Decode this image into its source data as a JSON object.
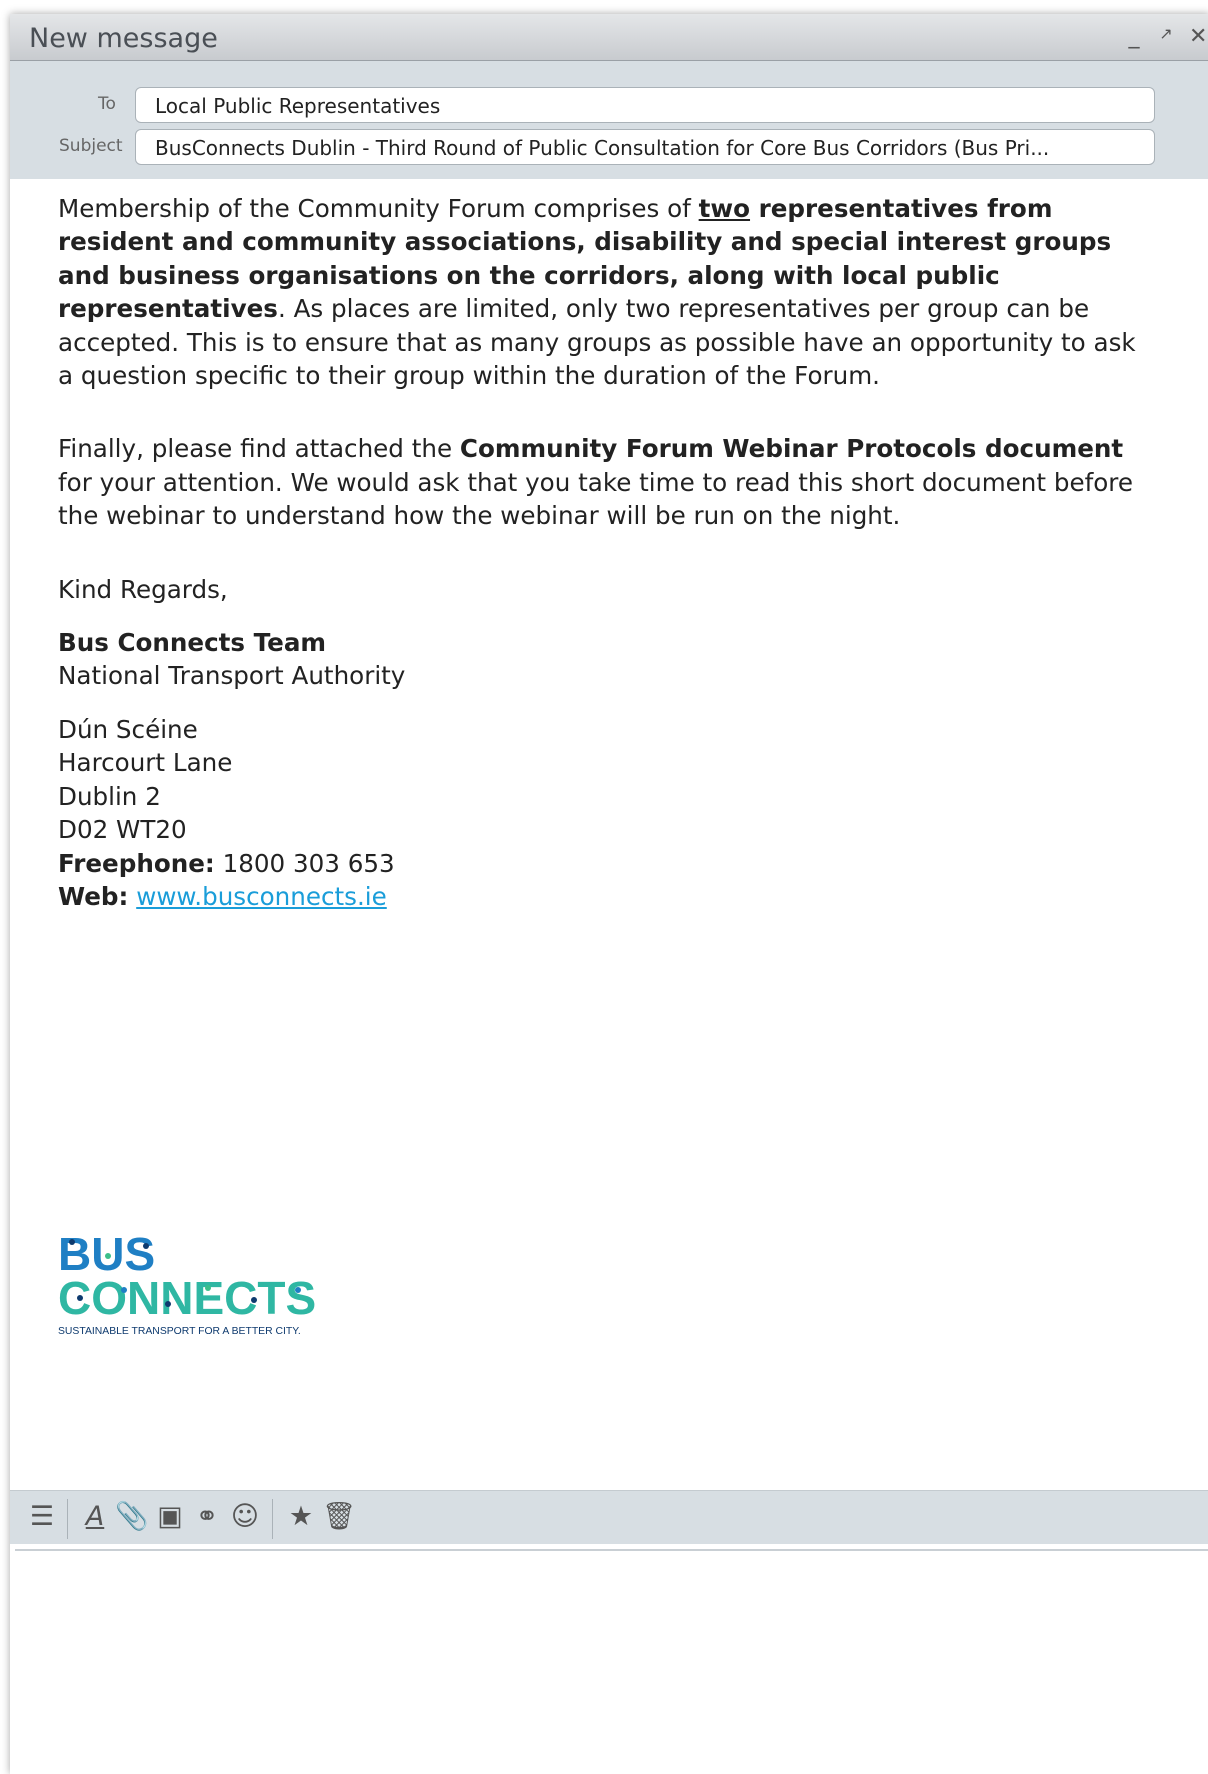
{
  "window": {
    "title": "New message",
    "controls": [
      "minimize-icon",
      "expand-icon",
      "close-icon"
    ]
  },
  "header": {
    "to_label": "To",
    "to_value": "Local Public Representatives",
    "subject_label": "Subject",
    "subject_value": "BusConnects Dublin - Third Round of Public Consultation for Core Bus Corridors (Bus Pri..."
  },
  "body": {
    "p1_a": "Membership of the Community Forum comprises of ",
    "p1_two": "two",
    "p1_bold": " representatives from resident and community associations, disability and special interest groups and business organisations on the corridors, along with local public representatives",
    "p1_b": ". As places are limited, only two representatives per group can be accepted. This is to ensure that as many groups as possible have an opportunity to ask a question specific to their group within the duration of the Forum.",
    "p2_a": "Finally, please find attached the ",
    "p2_bold": "Community Forum Webinar Protocols document",
    "p2_b": " for your attention. We would ask that you take time to read this short document before the webinar to understand how the webinar will be run on the night.",
    "regards": "Kind Regards,",
    "team": "Bus Connects Team",
    "org": "National Transport Authority",
    "addr1": "Dún Scéine",
    "addr2": "Harcourt Lane",
    "addr3": "Dublin 2",
    "addr4": "D02 WT20",
    "phone_label": "Freephone:",
    "phone": " 1800 303 653",
    "web_label": "Web:",
    "web": "www.busconnects.ie"
  },
  "logo": {
    "line1": "BUS",
    "line2": "CONNECTS",
    "tagline": "SUSTAINABLE TRANSPORT FOR A BETTER CITY.",
    "colors": {
      "blue": "#1f7fc4",
      "teal": "#2fb7a3",
      "dark": "#0e3a6e",
      "green": "#3bbf8a"
    }
  },
  "toolbar": {
    "icons": [
      "menu-icon",
      "text-format-icon",
      "attachment-icon",
      "image-icon",
      "link-icon",
      "emoji-icon",
      "star-icon",
      "trash-icon"
    ]
  }
}
